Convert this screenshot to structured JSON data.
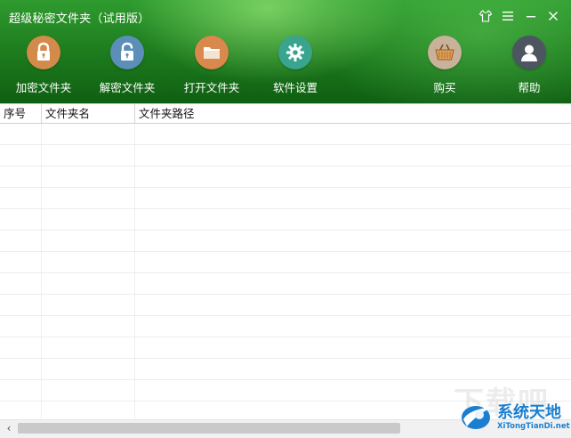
{
  "window": {
    "title": "超级秘密文件夹（试用版）"
  },
  "toolbar": {
    "encrypt_label": "加密文件夹",
    "decrypt_label": "解密文件夹",
    "open_label": "打开文件夹",
    "settings_label": "软件设置",
    "buy_label": "购买",
    "help_label": "帮助"
  },
  "table": {
    "columns": [
      "序号",
      "文件夹名",
      "文件夹路径"
    ],
    "rows": []
  },
  "watermark": {
    "faded": "下载吧",
    "brand": "系统天地",
    "url": "XiTongTianDi.net"
  },
  "colors": {
    "header_green": "#1f7f1f",
    "lock_orange": "#d38b4c",
    "unlock_blue": "#5b8fb8",
    "folder_orange": "#d9894b",
    "gear_teal": "#3aa58f",
    "basket_bg": "#c9b29a",
    "avatar_bg": "#4d5560"
  }
}
